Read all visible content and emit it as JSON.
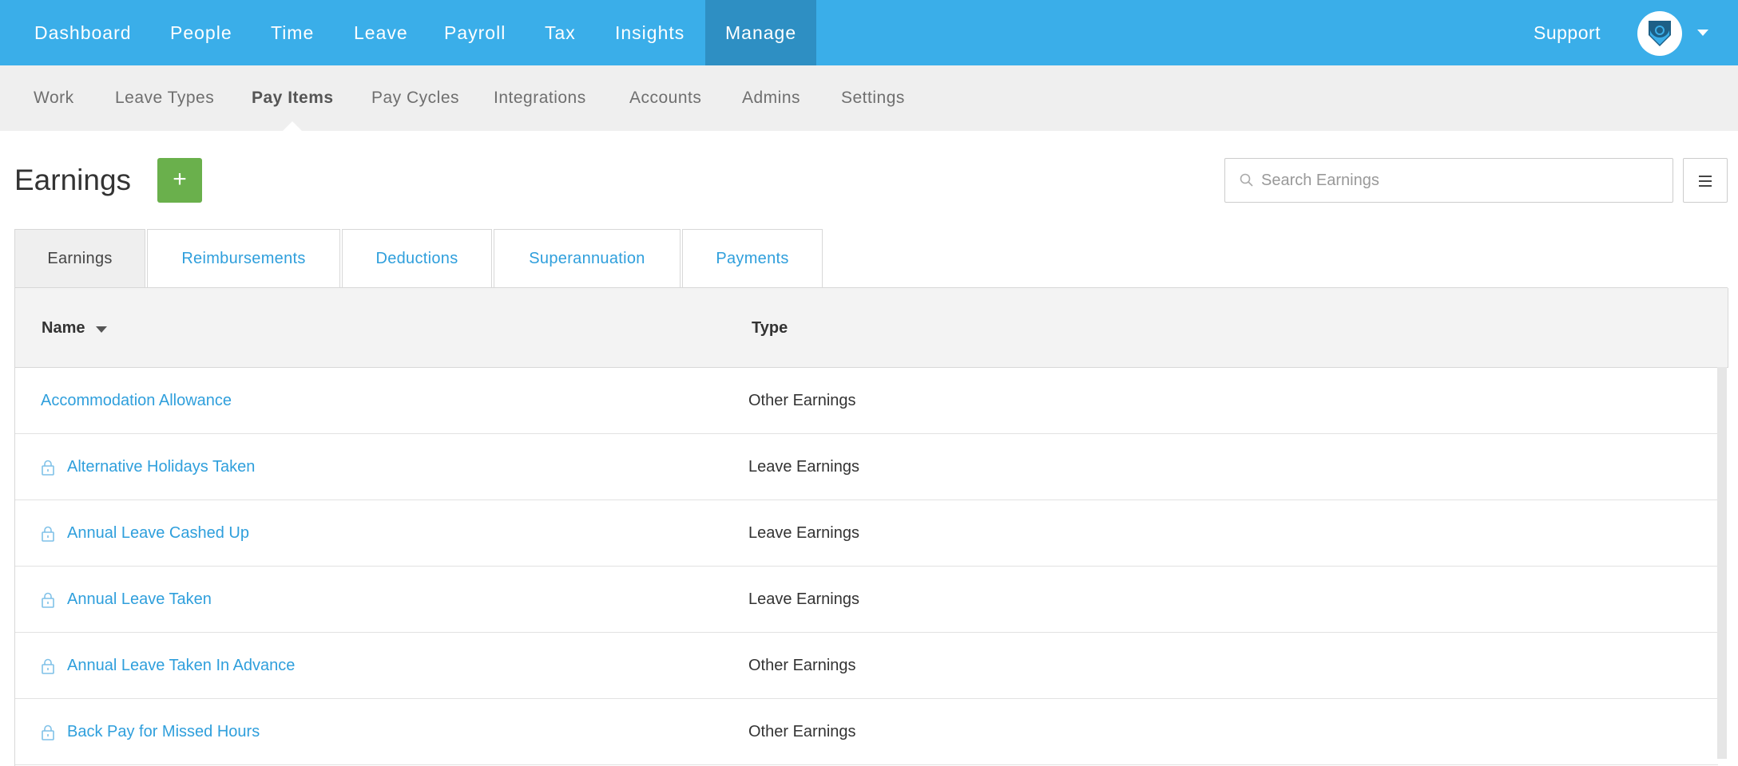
{
  "topnav": {
    "items": [
      "Dashboard",
      "People",
      "Time",
      "Leave",
      "Payroll",
      "Tax",
      "Insights",
      "Manage"
    ],
    "active": "Manage",
    "support": "Support"
  },
  "subnav": {
    "items": [
      "Work",
      "Leave Types",
      "Pay Items",
      "Pay Cycles",
      "Integrations",
      "Accounts",
      "Admins",
      "Settings"
    ],
    "active": "Pay Items"
  },
  "page": {
    "title": "Earnings",
    "add_label": "+",
    "search_placeholder": "Search Earnings"
  },
  "tabs": {
    "items": [
      "Earnings",
      "Reimbursements",
      "Deductions",
      "Superannuation",
      "Payments"
    ],
    "active": "Earnings"
  },
  "table": {
    "columns": [
      "Name",
      "Type"
    ],
    "sort": "Name descending",
    "rows": [
      {
        "name": "Accommodation Allowance",
        "type": "Other Earnings",
        "locked": false
      },
      {
        "name": "Alternative Holidays Taken",
        "type": "Leave Earnings",
        "locked": true
      },
      {
        "name": "Annual Leave Cashed Up",
        "type": "Leave Earnings",
        "locked": true
      },
      {
        "name": "Annual Leave Taken",
        "type": "Leave Earnings",
        "locked": true
      },
      {
        "name": "Annual Leave Taken In Advance",
        "type": "Other Earnings",
        "locked": true
      },
      {
        "name": "Back Pay for Missed Hours",
        "type": "Other Earnings",
        "locked": true
      }
    ]
  },
  "colors": {
    "topnav_bg": "#3aaee9",
    "topnav_active": "#2e8fc3",
    "link": "#2f9fdc",
    "add_button": "#6ab04c"
  }
}
